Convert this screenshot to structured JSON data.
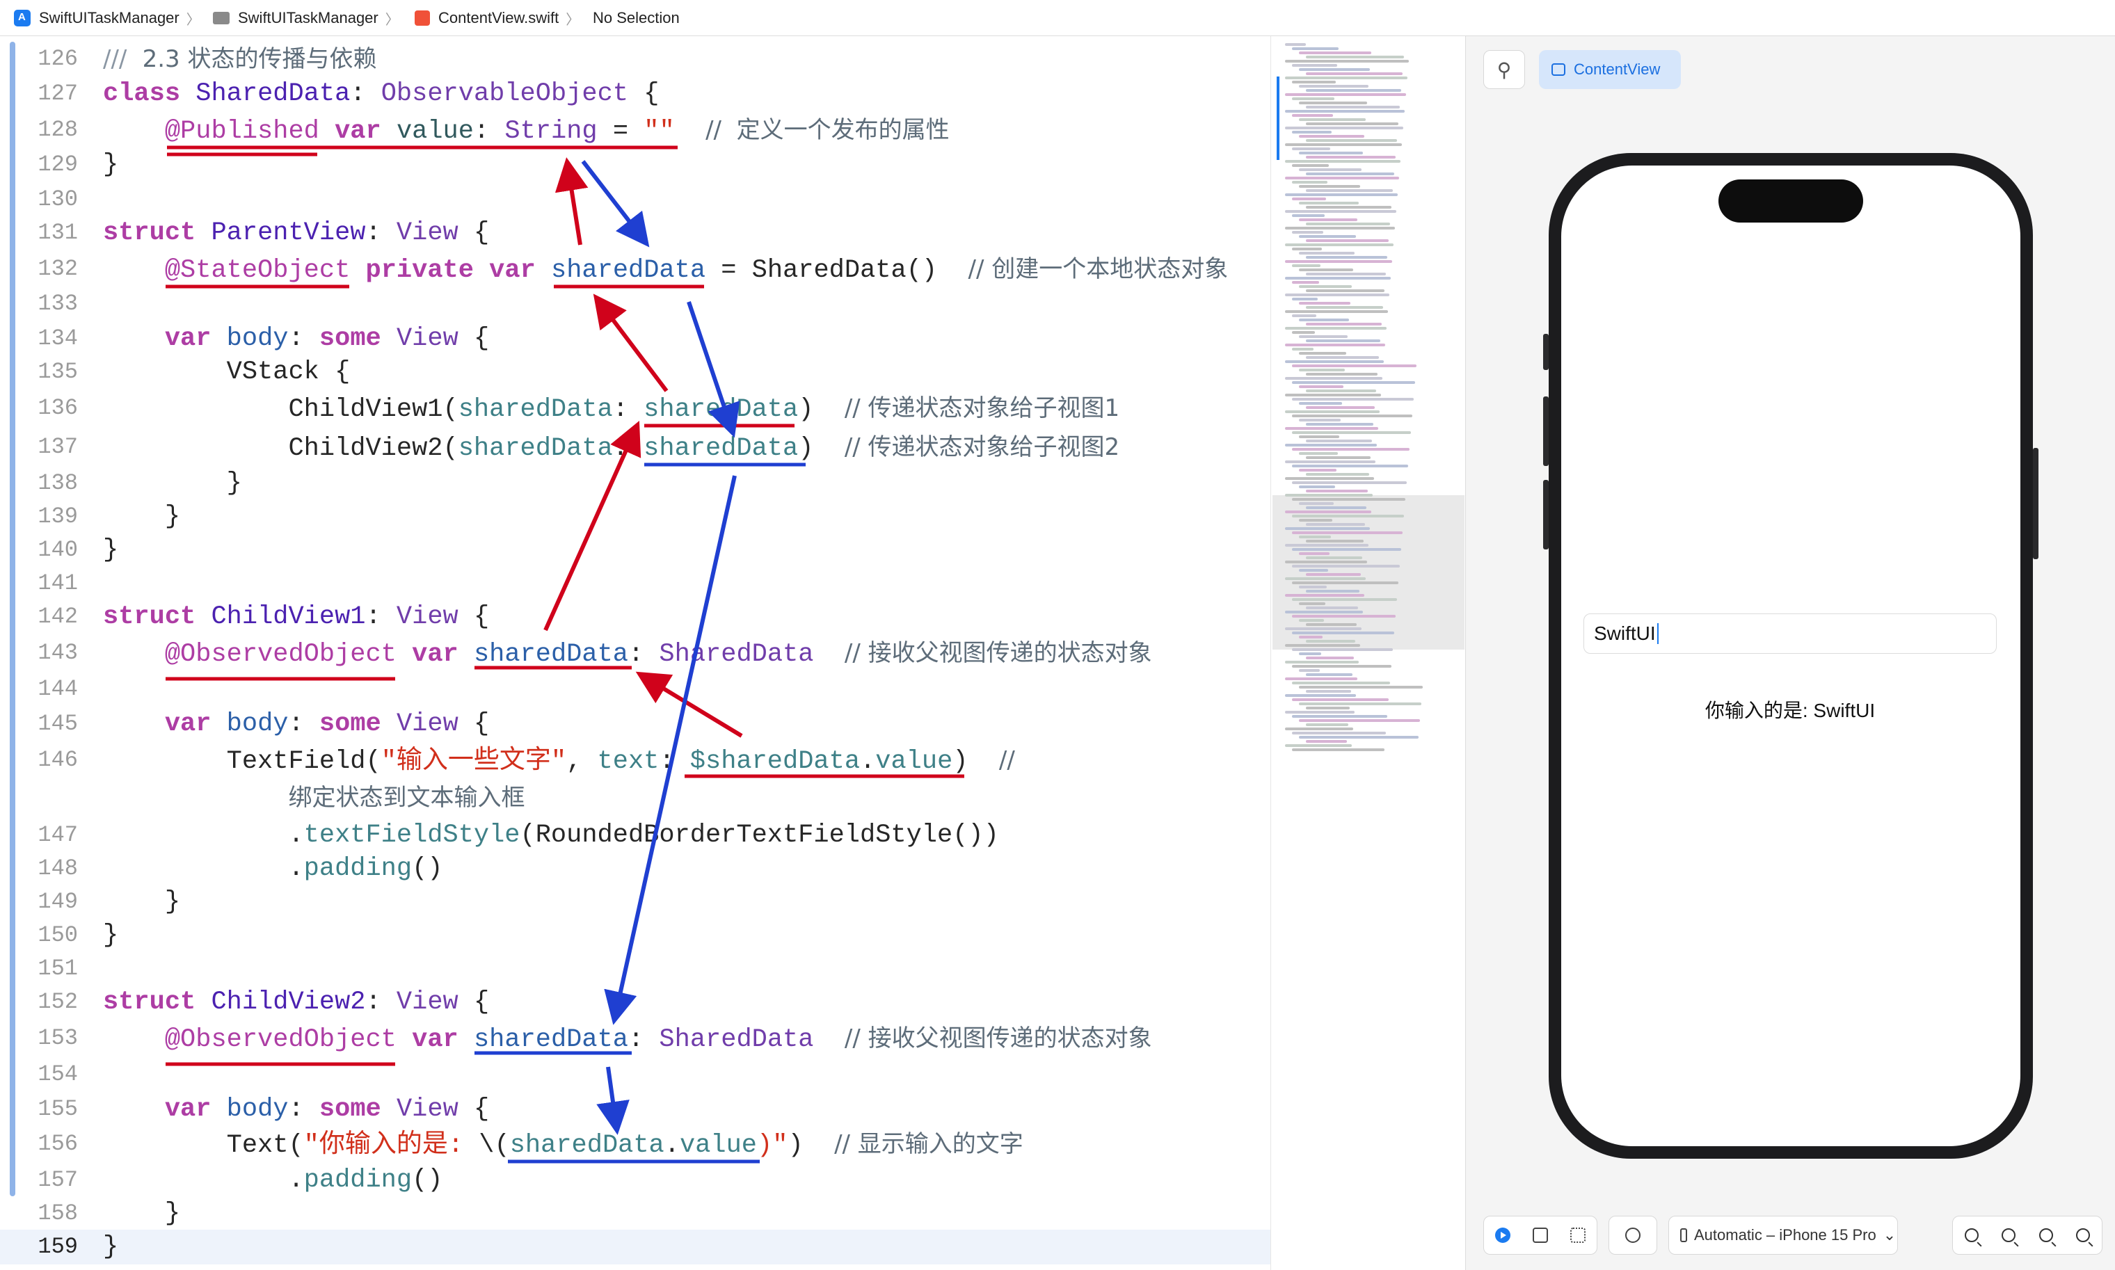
{
  "breadcrumb": {
    "project": "SwiftUITaskManager",
    "folder": "SwiftUITaskManager",
    "file": "ContentView.swift",
    "selection": "No Selection",
    "separator": "〉"
  },
  "editor": {
    "lines": [
      {
        "n": "126",
        "comment": "2.3 状态的传播与依赖"
      },
      {
        "n": "127"
      },
      {
        "n": "128"
      },
      {
        "n": "129"
      },
      {
        "n": "130"
      },
      {
        "n": "131"
      },
      {
        "n": "132"
      },
      {
        "n": "133"
      },
      {
        "n": "134"
      },
      {
        "n": "135"
      },
      {
        "n": "136"
      },
      {
        "n": "137"
      },
      {
        "n": "138"
      },
      {
        "n": "139"
      },
      {
        "n": "140"
      },
      {
        "n": "141"
      },
      {
        "n": "142"
      },
      {
        "n": "143"
      },
      {
        "n": "144"
      },
      {
        "n": "145"
      },
      {
        "n": "146"
      },
      {
        "n": "147"
      },
      {
        "n": "148"
      },
      {
        "n": "149"
      },
      {
        "n": "150"
      },
      {
        "n": "151"
      },
      {
        "n": "152"
      },
      {
        "n": "153"
      },
      {
        "n": "154"
      },
      {
        "n": "155"
      },
      {
        "n": "156"
      },
      {
        "n": "157"
      },
      {
        "n": "158"
      },
      {
        "n": "159"
      }
    ],
    "text": {
      "l126_slash": "///",
      "l127_class": "class",
      "l127_name": "SharedData",
      "l127_rest": ": ",
      "l127_proto": "ObservableObject",
      "l127_brace": " {",
      "l128_attr": "@Published",
      "l128_var": "var",
      "l128_name": "value",
      "l128_colon": ": ",
      "l128_type": "String",
      "l128_eq": " = ",
      "l128_str": "\"\"",
      "l128_comment": "//  定义一个发布的属性",
      "close": "}",
      "l131_struct": "struct",
      "l131_name": "ParentView",
      "l131_view": "View",
      "l132_attr": "@StateObject",
      "l132_private": "private",
      "l132_var": "var",
      "l132_name": "sharedData",
      "l132_init": " = SharedData()",
      "l132_comment": "// 创建一个本地状态对象",
      "l134_var": "var",
      "l134_body": "body",
      "l134_some": "some",
      "l134_view": "View",
      "l135_vstack": "VStack {",
      "l136_call": "ChildView1(",
      "l136_label": "sharedData",
      "l136_arg": "sharedData",
      "l136_comment": "// 传递状态对象给子视图1",
      "l137_call": "ChildView2(",
      "l137_label": "sharedData",
      "l137_arg": "sharedData",
      "l137_comment": "// 传递状态对象给子视图2",
      "l142_struct": "struct",
      "l142_name": "ChildView1",
      "l142_view": "View",
      "l143_attr": "@ObservedObject",
      "l143_var": "var",
      "l143_name": "sharedData",
      "l143_type": "SharedData",
      "l143_comment": "// 接收父视图传递的状态对象",
      "l145_var": "var",
      "l145_body": "body",
      "l145_some": "some",
      "l145_view": "View",
      "l146_call": "TextField(",
      "l146_str": "\"输入一些文字\"",
      "l146_label": "text",
      "l146_binding": "$sharedData",
      "l146_value": "value",
      "l146_comment": "//",
      "l146_wrap": "绑定状态到文本输入框",
      "l147_mod": "textFieldStyle",
      "l147_arg": "(RoundedBorderTextFieldStyle())",
      "l148_mod": "padding",
      "l152_struct": "struct",
      "l152_name": "ChildView2",
      "l152_view": "View",
      "l153_attr": "@ObservedObject",
      "l153_var": "var",
      "l153_name": "sharedData",
      "l153_type": "SharedData",
      "l153_comment": "// 接收父视图传递的状态对象",
      "l155_var": "var",
      "l155_body": "body",
      "l155_some": "some",
      "l155_view": "View",
      "l156_call": "Text(",
      "l156_str": "\"你输入的是: ",
      "l156_interp_open": "\\(",
      "l156_name": "sharedData",
      "l156_value": "value",
      "l156_interp_close": ")\"",
      "l156_comment": "// 显示输入的文字",
      "l157_mod": "padding"
    }
  },
  "canvas": {
    "tab_label": "ContentView",
    "textfield_value": "SwiftUI",
    "output_text": "你输入的是: SwiftUI",
    "device_label": "Automatic – iPhone 15 Pro"
  },
  "colors": {
    "red_arrow": "#d0021b",
    "blue_arrow": "#1f3fd1"
  }
}
